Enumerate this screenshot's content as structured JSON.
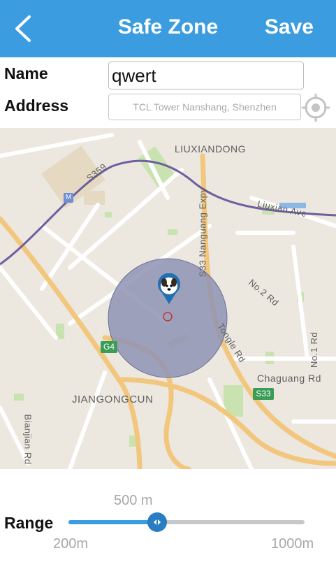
{
  "header": {
    "title": "Safe Zone",
    "save_label": "Save",
    "accent_color": "#3b9ddf"
  },
  "form": {
    "name_label": "Name",
    "name_value": "qwert",
    "address_label": "Address",
    "address_placeholder": "TCL Tower Nanshang, Shenzhen"
  },
  "map": {
    "labels": {
      "liuxiandong": "LIUXIANDONG",
      "s359": "S359",
      "liuxian_ave": "Liuxian Ave",
      "s33_expy": "S33 Nanguang Expy",
      "no2": "No.2 Rd",
      "no1": "No.1 Rd",
      "tongle": "Tongle Rd",
      "chaguang": "Chaguang Rd",
      "s33": "S33",
      "g4": "G4",
      "jiangongcun": "JIANGONGCUN",
      "bianjian": "Bianjian Rd",
      "metro": "M"
    },
    "zone_color": "#8f93b5"
  },
  "range": {
    "label": "Range",
    "current": "500 m",
    "min": "200m",
    "max": "1000m",
    "fraction": 0.375
  }
}
